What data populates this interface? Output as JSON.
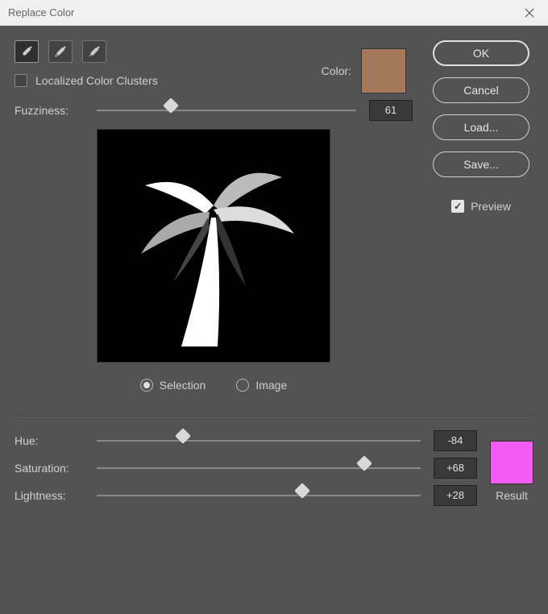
{
  "title": "Replace Color",
  "buttons": {
    "ok": "OK",
    "cancel": "Cancel",
    "load": "Load...",
    "save": "Save..."
  },
  "preview_label": "Preview",
  "preview_checked": "✓",
  "color_label": "Color:",
  "sample_color": "#a6785b",
  "localized_label": "Localized Color Clusters",
  "fuzziness_label": "Fuzziness:",
  "fuzziness_value": "61",
  "fuzziness_pos": "28%",
  "radio_selection": "Selection",
  "radio_image": "Image",
  "hue_label": "Hue:",
  "hue_value": "-84",
  "hue_pos": "26%",
  "sat_label": "Saturation:",
  "sat_value": "+68",
  "sat_pos": "82%",
  "light_label": "Lightness:",
  "light_value": "+28",
  "light_pos": "63%",
  "result_label": "Result",
  "result_color": "#f25cf2"
}
